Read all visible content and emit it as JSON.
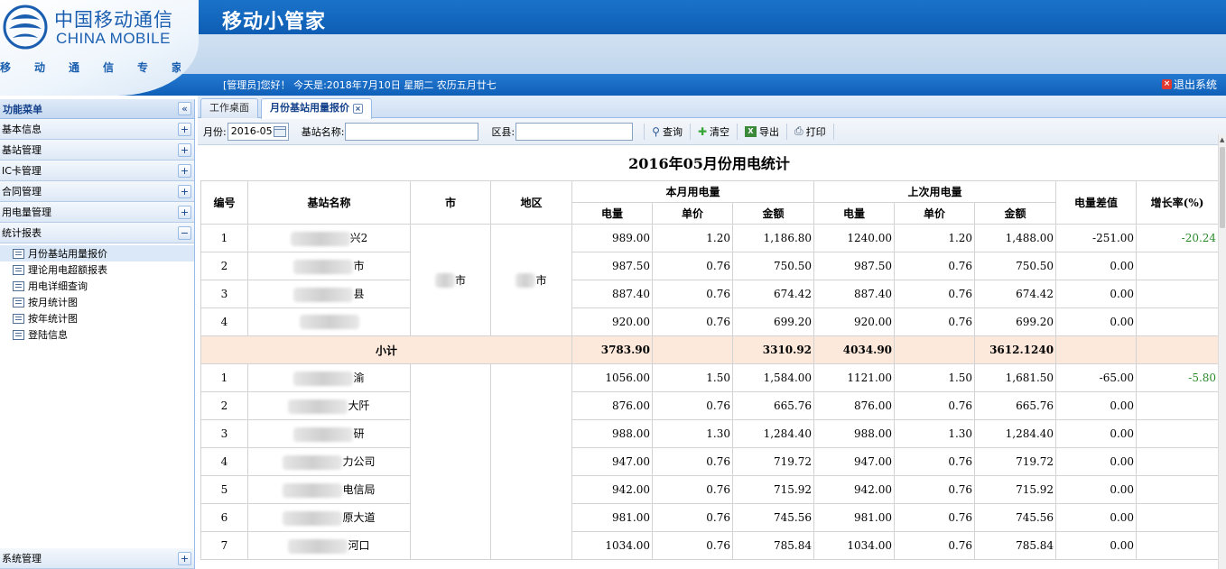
{
  "header": {
    "logo_cn": "中国移动通信",
    "logo_en": "CHINA MOBILE",
    "logo_slogan": "移动通信专家",
    "app_title": "移动小管家",
    "welcome": "[管理员]您好！ 今天是:2018年7月10日 星期二 农历五月廿七",
    "logout_label": "退出系统"
  },
  "sidebar": {
    "title": "功能菜单",
    "collapse_symbol": "«",
    "sections": [
      {
        "label": "基本信息",
        "symbol": "+"
      },
      {
        "label": "基站管理",
        "symbol": "+"
      },
      {
        "label": "IC卡管理",
        "symbol": "+"
      },
      {
        "label": "合同管理",
        "symbol": "+"
      },
      {
        "label": "用电量管理",
        "symbol": "+"
      },
      {
        "label": "统计报表",
        "symbol": "−"
      }
    ],
    "items": [
      {
        "label": "月份基站用量报价"
      },
      {
        "label": "理论用电超额报表"
      },
      {
        "label": "用电详细查询"
      },
      {
        "label": "按月统计图"
      },
      {
        "label": "按年统计图"
      },
      {
        "label": "登陆信息"
      }
    ],
    "bottom_section": {
      "label": "系统管理",
      "symbol": "+"
    }
  },
  "tabs": [
    {
      "label": "工作桌面"
    },
    {
      "label": "月份基站用量报价"
    }
  ],
  "toolbar": {
    "month_label": "月份:",
    "month_value": "2016-05",
    "station_label": "基站名称:",
    "district_label": "区县:",
    "query_label": "查询",
    "clear_label": "清空",
    "export_label": "导出",
    "print_label": "打印"
  },
  "report": {
    "title": "2016年05月份用电统计",
    "headers": {
      "no": "编号",
      "station": "基站名称",
      "city": "市",
      "area": "地区",
      "current_group": "本月用电量",
      "previous_group": "上次用电量",
      "diff": "电量差值",
      "growth": "增长率(%)",
      "kwh": "电量",
      "price": "单价",
      "amount": "金额"
    },
    "group1": {
      "city_suffix": "市",
      "area_suffix": "市",
      "rows": [
        {
          "no": "1",
          "name_suffix": "兴2",
          "cur_kwh": "989.00",
          "cur_price": "1.20",
          "cur_amount": "1,186.80",
          "prev_kwh": "1240.00",
          "prev_price": "1.20",
          "prev_amount": "1,488.00",
          "diff": "-251.00",
          "growth": "-20.24"
        },
        {
          "no": "2",
          "name_suffix": "市",
          "cur_kwh": "987.50",
          "cur_price": "0.76",
          "cur_amount": "750.50",
          "prev_kwh": "987.50",
          "prev_price": "0.76",
          "prev_amount": "750.50",
          "diff": "0.00",
          "growth": ""
        },
        {
          "no": "3",
          "name_suffix": "县",
          "cur_kwh": "887.40",
          "cur_price": "0.76",
          "cur_amount": "674.42",
          "prev_kwh": "887.40",
          "prev_price": "0.76",
          "prev_amount": "674.42",
          "diff": "0.00",
          "growth": ""
        },
        {
          "no": "4",
          "name_suffix": "",
          "cur_kwh": "920.00",
          "cur_price": "0.76",
          "cur_amount": "699.20",
          "prev_kwh": "920.00",
          "prev_price": "0.76",
          "prev_amount": "699.20",
          "diff": "0.00",
          "growth": ""
        }
      ],
      "subtotal": {
        "label": "小计",
        "cur_kwh": "3783.90",
        "cur_amount": "3310.92",
        "prev_kwh": "4034.90",
        "prev_amount": "3612.1240"
      }
    },
    "group2": {
      "rows": [
        {
          "no": "1",
          "name_suffix": "渝",
          "cur_kwh": "1056.00",
          "cur_price": "1.50",
          "cur_amount": "1,584.00",
          "prev_kwh": "1121.00",
          "prev_price": "1.50",
          "prev_amount": "1,681.50",
          "diff": "-65.00",
          "growth": "-5.80"
        },
        {
          "no": "2",
          "name_suffix": "大阡",
          "cur_kwh": "876.00",
          "cur_price": "0.76",
          "cur_amount": "665.76",
          "prev_kwh": "876.00",
          "prev_price": "0.76",
          "prev_amount": "665.76",
          "diff": "0.00",
          "growth": ""
        },
        {
          "no": "3",
          "name_suffix": "研",
          "cur_kwh": "988.00",
          "cur_price": "1.30",
          "cur_amount": "1,284.40",
          "prev_kwh": "988.00",
          "prev_price": "1.30",
          "prev_amount": "1,284.40",
          "diff": "0.00",
          "growth": ""
        },
        {
          "no": "4",
          "name_suffix": "力公司",
          "cur_kwh": "947.00",
          "cur_price": "0.76",
          "cur_amount": "719.72",
          "prev_kwh": "947.00",
          "prev_price": "0.76",
          "prev_amount": "719.72",
          "diff": "0.00",
          "growth": ""
        },
        {
          "no": "5",
          "name_suffix": "电信局",
          "cur_kwh": "942.00",
          "cur_price": "0.76",
          "cur_amount": "715.92",
          "prev_kwh": "942.00",
          "prev_price": "0.76",
          "prev_amount": "715.92",
          "diff": "0.00",
          "growth": ""
        },
        {
          "no": "6",
          "name_suffix": "原大道",
          "cur_kwh": "981.00",
          "cur_price": "0.76",
          "cur_amount": "745.56",
          "prev_kwh": "981.00",
          "prev_price": "0.76",
          "prev_amount": "745.56",
          "diff": "0.00",
          "growth": ""
        },
        {
          "no": "7",
          "name_suffix": "河口",
          "cur_kwh": "1034.00",
          "cur_price": "0.76",
          "cur_amount": "785.84",
          "prev_kwh": "1034.00",
          "prev_price": "0.76",
          "prev_amount": "785.84",
          "diff": "0.00",
          "growth": ""
        }
      ]
    }
  },
  "colors": {
    "header_blue": "#1a73c9",
    "brand_text": "#1a5eb0",
    "subtotal_bg": "#fde9dc",
    "growth_green": "#2a8a2a",
    "logout_red": "#e23a2e"
  }
}
